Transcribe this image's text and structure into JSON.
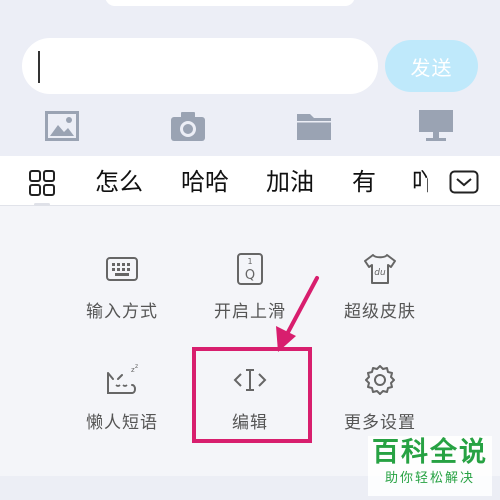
{
  "chat": {
    "input_value": "",
    "send_label": "发送",
    "tools": [
      {
        "icon": "image-icon"
      },
      {
        "icon": "camera-icon"
      },
      {
        "icon": "folder-icon"
      },
      {
        "icon": "monitor-icon"
      }
    ]
  },
  "candidates": {
    "items": [
      "怎么",
      "哈哈",
      "加油",
      "有",
      "吖"
    ]
  },
  "panel": {
    "items": [
      {
        "label": "输入方式",
        "icon": "keyboard-icon"
      },
      {
        "label": "开启上滑",
        "icon": "swipe-key-icon"
      },
      {
        "label": "超级皮肤",
        "icon": "tshirt-skin-icon"
      },
      {
        "label": "懒人短语",
        "icon": "sleepy-cat-icon"
      },
      {
        "label": "编辑",
        "icon": "text-cursor-icon"
      },
      {
        "label": "更多设置",
        "icon": "gear-icon"
      }
    ],
    "swipe_key_chars": {
      "top": "1",
      "bottom": "Q"
    },
    "skin_text": "du"
  },
  "colors": {
    "accent_send": "#bfe9fb",
    "highlight": "#d81e6e",
    "watermark": "#27a243"
  },
  "watermark": {
    "title": "百科全说",
    "subtitle": "助你轻松解决"
  }
}
